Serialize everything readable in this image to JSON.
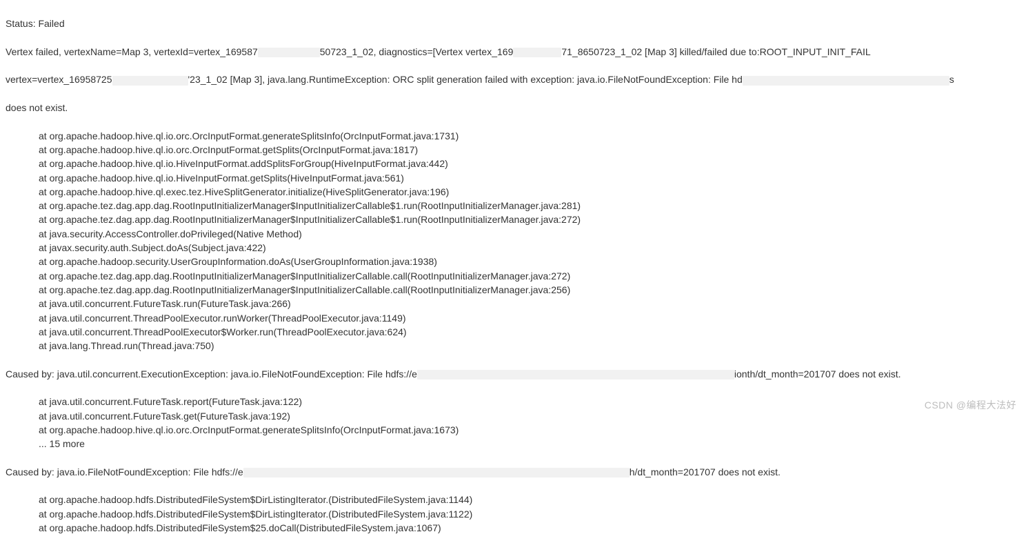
{
  "status": "Status: Failed",
  "header1a": "Vertex failed, vertexName=Map 3, vertexId=vertex_169587",
  "header1b": "50723_1_02, diagnostics=[Vertex vertex_169",
  "header1c": "71_8650723_1_02 [Map 3] killed/failed due to:ROOT_INPUT_INIT_FAIL",
  "header2a": "vertex=vertex_16958725",
  "header2b": "'23_1_02 [Map 3], java.lang.RuntimeException: ORC split generation failed with exception: java.io.FileNotFoundException: File hd",
  "header3": "does not exist.",
  "stack1": [
    "at org.apache.hadoop.hive.ql.io.orc.OrcInputFormat.generateSplitsInfo(OrcInputFormat.java:1731)",
    "at org.apache.hadoop.hive.ql.io.orc.OrcInputFormat.getSplits(OrcInputFormat.java:1817)",
    "at org.apache.hadoop.hive.ql.io.HiveInputFormat.addSplitsForGroup(HiveInputFormat.java:442)",
    "at org.apache.hadoop.hive.ql.io.HiveInputFormat.getSplits(HiveInputFormat.java:561)",
    "at org.apache.hadoop.hive.ql.exec.tez.HiveSplitGenerator.initialize(HiveSplitGenerator.java:196)",
    "at org.apache.tez.dag.app.dag.RootInputInitializerManager$InputInitializerCallable$1.run(RootInputInitializerManager.java:281)",
    "at org.apache.tez.dag.app.dag.RootInputInitializerManager$InputInitializerCallable$1.run(RootInputInitializerManager.java:272)",
    "at java.security.AccessController.doPrivileged(Native Method)",
    "at javax.security.auth.Subject.doAs(Subject.java:422)",
    "at org.apache.hadoop.security.UserGroupInformation.doAs(UserGroupInformation.java:1938)",
    "at org.apache.tez.dag.app.dag.RootInputInitializerManager$InputInitializerCallable.call(RootInputInitializerManager.java:272)",
    "at org.apache.tez.dag.app.dag.RootInputInitializerManager$InputInitializerCallable.call(RootInputInitializerManager.java:256)",
    "at java.util.concurrent.FutureTask.run(FutureTask.java:266)",
    "at java.util.concurrent.ThreadPoolExecutor.runWorker(ThreadPoolExecutor.java:1149)",
    "at java.util.concurrent.ThreadPoolExecutor$Worker.run(ThreadPoolExecutor.java:624)",
    "at java.lang.Thread.run(Thread.java:750)"
  ],
  "cause1a": "Caused by: java.util.concurrent.ExecutionException: java.io.FileNotFoundException: File hdfs://e",
  "cause1b": "ionth/dt_month=201707 does not exist.",
  "stack2": [
    "at java.util.concurrent.FutureTask.report(FutureTask.java:122)",
    "at java.util.concurrent.FutureTask.get(FutureTask.java:192)",
    "at org.apache.hadoop.hive.ql.io.orc.OrcInputFormat.generateSplitsInfo(OrcInputFormat.java:1673)",
    "... 15 more"
  ],
  "cause2a": "Caused by: java.io.FileNotFoundException: File hdfs://e",
  "cause2b": "h/dt_month=201707 does not exist.",
  "stack3": [
    "at org.apache.hadoop.hdfs.DistributedFileSystem$DirListingIterator.(DistributedFileSystem.java:1144)",
    "at org.apache.hadoop.hdfs.DistributedFileSystem$DirListingIterator.(DistributedFileSystem.java:1122)",
    "at org.apache.hadoop.hdfs.DistributedFileSystem$25.doCall(DistributedFileSystem.java:1067)"
  ],
  "watermark": "CSDN @编程大法好"
}
